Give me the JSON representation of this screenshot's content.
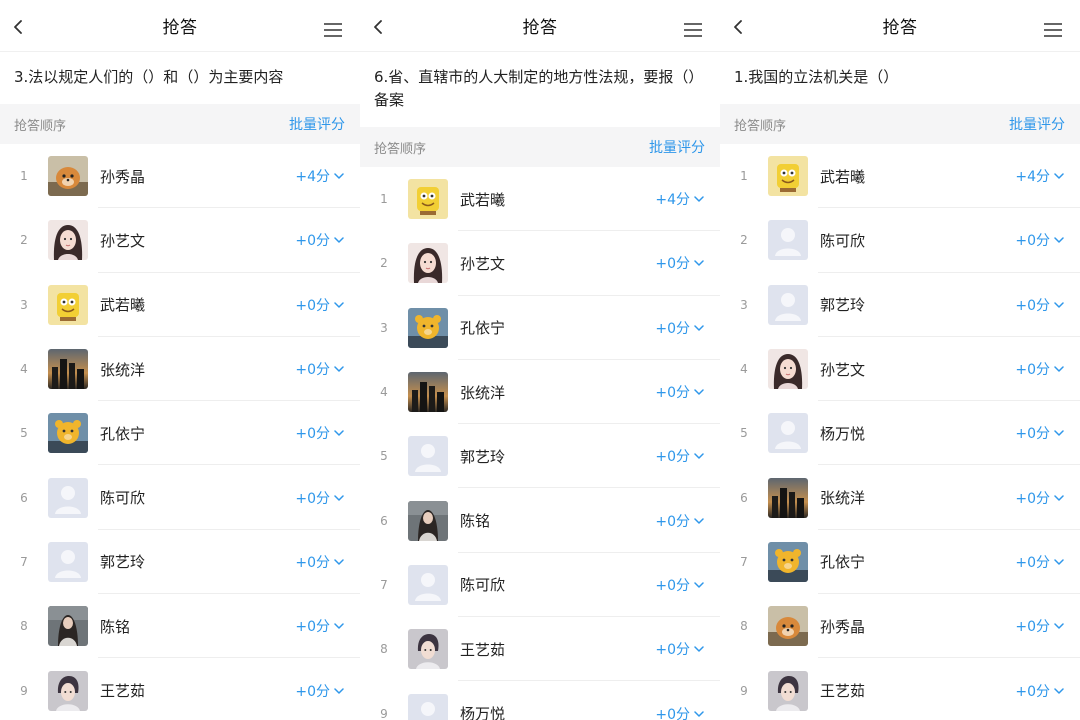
{
  "colors": {
    "accent": "#2f97ea",
    "section_bg": "#f5f5f6"
  },
  "panels": [
    {
      "title": "抢答",
      "question": "3.法以规定人们的（）和（）为主要内容",
      "section_label": "抢答顺序",
      "bulk_label": "批量评分",
      "rows": [
        {
          "rank": "1",
          "name": "孙秀晶",
          "score": "+4分",
          "avatar": "dog"
        },
        {
          "rank": "2",
          "name": "孙艺文",
          "score": "+0分",
          "avatar": "girl"
        },
        {
          "rank": "3",
          "name": "武若曦",
          "score": "+0分",
          "avatar": "cartoon"
        },
        {
          "rank": "4",
          "name": "张统洋",
          "score": "+0分",
          "avatar": "city"
        },
        {
          "rank": "5",
          "name": "孔依宁",
          "score": "+0分",
          "avatar": "bear"
        },
        {
          "rank": "6",
          "name": "陈可欣",
          "score": "+0分",
          "avatar": "default"
        },
        {
          "rank": "7",
          "name": "郭艺玲",
          "score": "+0分",
          "avatar": "default"
        },
        {
          "rank": "8",
          "name": "陈铭",
          "score": "+0分",
          "avatar": "woman"
        },
        {
          "rank": "9",
          "name": "王艺茹",
          "score": "+0分",
          "avatar": "boy"
        }
      ]
    },
    {
      "title": "抢答",
      "question": "6.省、直辖市的人大制定的地方性法规，要报（）备案",
      "section_label": "抢答顺序",
      "bulk_label": "批量评分",
      "rows": [
        {
          "rank": "1",
          "name": "武若曦",
          "score": "+4分",
          "avatar": "cartoon"
        },
        {
          "rank": "2",
          "name": "孙艺文",
          "score": "+0分",
          "avatar": "girl"
        },
        {
          "rank": "3",
          "name": "孔依宁",
          "score": "+0分",
          "avatar": "bear"
        },
        {
          "rank": "4",
          "name": "张统洋",
          "score": "+0分",
          "avatar": "city"
        },
        {
          "rank": "5",
          "name": "郭艺玲",
          "score": "+0分",
          "avatar": "default"
        },
        {
          "rank": "6",
          "name": "陈铭",
          "score": "+0分",
          "avatar": "woman"
        },
        {
          "rank": "7",
          "name": "陈可欣",
          "score": "+0分",
          "avatar": "default"
        },
        {
          "rank": "8",
          "name": "王艺茹",
          "score": "+0分",
          "avatar": "boy"
        },
        {
          "rank": "9",
          "name": "杨万悦",
          "score": "+0分",
          "avatar": "default"
        }
      ]
    },
    {
      "title": "抢答",
      "question": "1.我国的立法机关是（）",
      "section_label": "抢答顺序",
      "bulk_label": "批量评分",
      "rows": [
        {
          "rank": "1",
          "name": "武若曦",
          "score": "+4分",
          "avatar": "cartoon"
        },
        {
          "rank": "2",
          "name": "陈可欣",
          "score": "+0分",
          "avatar": "default"
        },
        {
          "rank": "3",
          "name": "郭艺玲",
          "score": "+0分",
          "avatar": "default"
        },
        {
          "rank": "4",
          "name": "孙艺文",
          "score": "+0分",
          "avatar": "girl"
        },
        {
          "rank": "5",
          "name": "杨万悦",
          "score": "+0分",
          "avatar": "default"
        },
        {
          "rank": "6",
          "name": "张统洋",
          "score": "+0分",
          "avatar": "city"
        },
        {
          "rank": "7",
          "name": "孔依宁",
          "score": "+0分",
          "avatar": "bear"
        },
        {
          "rank": "8",
          "name": "孙秀晶",
          "score": "+0分",
          "avatar": "dog"
        },
        {
          "rank": "9",
          "name": "王艺茹",
          "score": "+0分",
          "avatar": "boy"
        }
      ]
    }
  ]
}
